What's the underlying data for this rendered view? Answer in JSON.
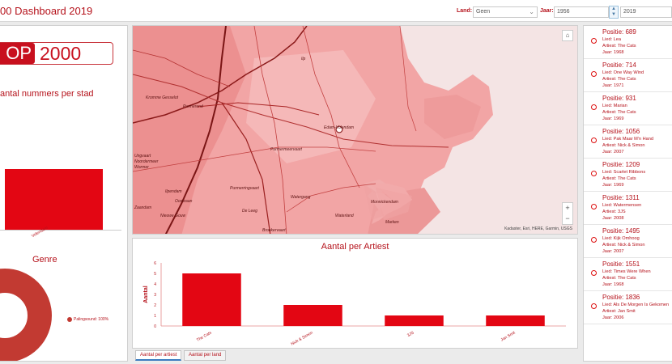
{
  "header": {
    "title": "00 Dashboard 2019",
    "land_label": "Land:",
    "land_value": "Geen",
    "jaar_label": "Jaar:",
    "jaar_from": "1956",
    "jaar_to": "2019"
  },
  "left": {
    "logo_left": "OP",
    "logo_right": "2000",
    "city_title": "antal nummers per stad",
    "city_tick": "Volendam",
    "genre_title": "Genre",
    "genre_legend": "Palingsound: 100%"
  },
  "map": {
    "labels": [
      "Ilp",
      "Kromme Gesselot",
      "Purmerend",
      "Edam-Volendam",
      "Purmermeervaart",
      "Purmerringvaart",
      "Ilpendam",
      "Watergang",
      "De Leeg",
      "Broekervaart",
      "Ungvaart",
      "Noordermeer",
      "Wormer",
      "Oostzaan",
      "Zaandam",
      "Waterland",
      "Nieuwe Gouw",
      "Monnickendam",
      "Marken"
    ],
    "attribution": "Kadaster, Esri, HERE, Garmin, USGS"
  },
  "artist_chart": {
    "title": "Aantal per Artiest",
    "ylabel": "Aantal"
  },
  "chart_data": {
    "type": "bar",
    "title": "Aantal per Artiest",
    "xlabel": "",
    "ylabel": "Aantal",
    "categories": [
      "The Cats",
      "Nick & Simon",
      "3JS",
      "Jan Smit"
    ],
    "values": [
      5,
      2,
      1,
      1
    ],
    "ylim": [
      0,
      6
    ],
    "yticks": [
      "0",
      "1",
      "2",
      "3",
      "4",
      "5",
      "6"
    ],
    "color": "#e30613",
    "grid": false
  },
  "tabs": [
    "Aantal per artiest",
    "Aantal per land"
  ],
  "songs": [
    {
      "positie": "Positie: 689",
      "lied": "Lied: Lea",
      "artiest": "Artiest: The Cats",
      "jaar": "Jaar: 1968"
    },
    {
      "positie": "Positie: 714",
      "lied": "Lied: One Way Wind",
      "artiest": "Artiest: The Cats",
      "jaar": "Jaar: 1971"
    },
    {
      "positie": "Positie: 931",
      "lied": "Lied: Marian",
      "artiest": "Artiest: The Cats",
      "jaar": "Jaar: 1969"
    },
    {
      "positie": "Positie: 1056",
      "lied": "Lied: Pak Maar M'n Hand",
      "artiest": "Artiest: Nick & Simon",
      "jaar": "Jaar: 2007"
    },
    {
      "positie": "Positie: 1209",
      "lied": "Lied: Scarlet Ribbons",
      "artiest": "Artiest: The Cats",
      "jaar": "Jaar: 1969"
    },
    {
      "positie": "Positie: 1311",
      "lied": "Lied: Watermensen",
      "artiest": "Artiest: 3JS",
      "jaar": "Jaar: 2008"
    },
    {
      "positie": "Positie: 1495",
      "lied": "Lied: Kijk Omhoog",
      "artiest": "Artiest: Nick & Simon",
      "jaar": "Jaar: 2007"
    },
    {
      "positie": "Positie: 1551",
      "lied": "Lied: Times Were When",
      "artiest": "Artiest: The Cats",
      "jaar": "Jaar: 1968"
    },
    {
      "positie": "Positie: 1836",
      "lied": "Lied: Als De Morgen Is Gekomen",
      "artiest": "Artiest: Jan Smit",
      "jaar": "Jaar: 2006"
    }
  ],
  "colors": {
    "accent": "#b5121b",
    "bar": "#e30613",
    "donut": "#c23a32"
  }
}
